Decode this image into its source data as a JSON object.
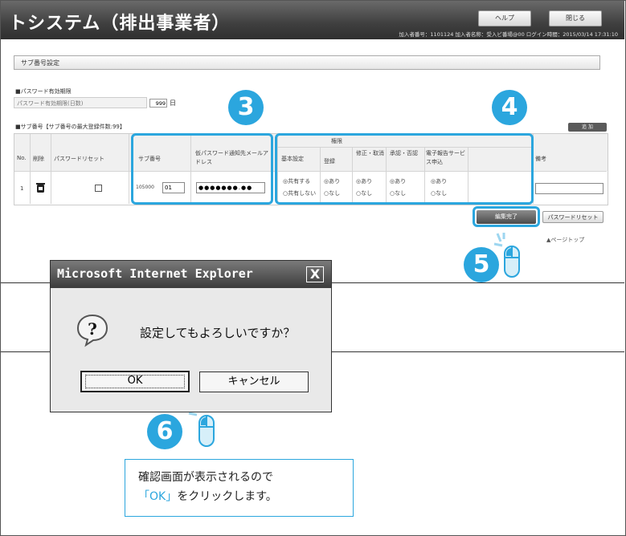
{
  "header": {
    "title": "トシステム（排出事業者）",
    "help_label": "ヘルプ",
    "close_label": "閉じる",
    "info_text": "加入者番号：1101124 加入者名称：受入ビ番場@00 ログイン時間：2015/03/14 17:31:10"
  },
  "section": {
    "title": "サブ番号設定"
  },
  "password": {
    "heading": "■パスワード有効期限",
    "label": "パスワード有効期限(日数)",
    "value": "999",
    "unit": "日"
  },
  "subnumber": {
    "heading": "■サブ番号【サブ番号の最大登録件数:99】",
    "add_label": "追 加",
    "columns": {
      "no": "No.",
      "delete": "削除",
      "pw_reset": "パスワードリセット",
      "sub_no": "サブ番号",
      "mail": "仮パスワード通知先メールアドレス",
      "basic": "基本設定",
      "perm_group": "権限",
      "register": "登録",
      "modify": "修正・取消",
      "approve": "承認・否認",
      "e_report": "電子報告サービス申込",
      "remarks": "備考"
    },
    "row": {
      "no": "1",
      "sub_no_prefix": "105000",
      "sub_no_value": "01",
      "mail_value": "●●●●●●●.●●",
      "basic_opt1": "◎共有する",
      "basic_opt2": "○共有しない",
      "opt_yes": "◎あり",
      "opt_no": "○なし"
    },
    "done_label": "編集完了",
    "reset_label": "パスワードリセット",
    "pagetop_label": "▲ページトップ"
  },
  "badges": {
    "b3": "3",
    "b4": "4",
    "b5": "5",
    "b6": "6"
  },
  "dialog": {
    "title": "Microsoft Internet Explorer",
    "close_glyph": "X",
    "message": "設定してもよろしいですか？",
    "ok_label": "OK",
    "cancel_label": "キャンセル"
  },
  "callout": {
    "line1": "確認画面が表示されるので",
    "ok_word": "「OK」",
    "line2_rest": "をクリックします。"
  },
  "colors": {
    "accent": "#2ba6de"
  }
}
